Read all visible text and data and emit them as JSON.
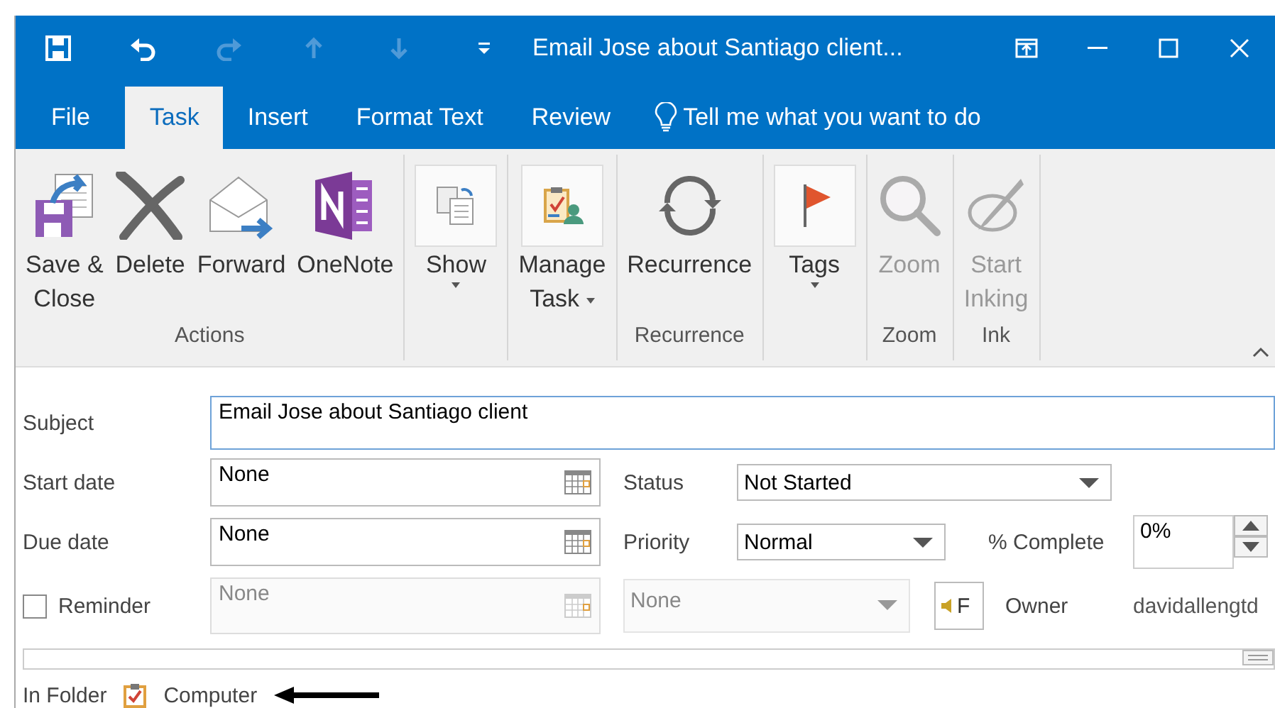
{
  "window": {
    "title": "Email Jose about Santiago client..."
  },
  "tabs": [
    {
      "label": "File",
      "selected": false
    },
    {
      "label": "Task",
      "selected": true
    },
    {
      "label": "Insert",
      "selected": false
    },
    {
      "label": "Format Text",
      "selected": false
    },
    {
      "label": "Review",
      "selected": false
    }
  ],
  "tell_me": {
    "placeholder": "Tell me what you want to do"
  },
  "ribbon": {
    "groups": [
      {
        "label": "Actions",
        "buttons": [
          {
            "kind": "save-close",
            "lines": [
              "Save &",
              "Close"
            ],
            "dropdown": false,
            "disabled": false,
            "framed": false
          },
          {
            "kind": "delete",
            "lines": [
              "Delete"
            ],
            "dropdown": false,
            "disabled": false,
            "framed": false
          },
          {
            "kind": "forward",
            "lines": [
              "Forward"
            ],
            "dropdown": false,
            "disabled": false,
            "framed": false
          },
          {
            "kind": "onenote",
            "lines": [
              "OneNote"
            ],
            "dropdown": false,
            "disabled": false,
            "framed": false
          }
        ]
      },
      {
        "buttons": [
          {
            "kind": "show",
            "lines": [
              "Show"
            ],
            "dropdown": true,
            "disabled": false,
            "framed": true
          }
        ]
      },
      {
        "buttons": [
          {
            "kind": "manage",
            "lines": [
              "Manage",
              "Task"
            ],
            "dropdown": true,
            "disabled": false,
            "framed": true
          }
        ]
      },
      {
        "label": "Recurrence",
        "buttons": [
          {
            "kind": "recurrence",
            "lines": [
              "Recurrence"
            ],
            "dropdown": false,
            "disabled": false,
            "framed": false
          }
        ]
      },
      {
        "buttons": [
          {
            "kind": "tags",
            "lines": [
              "Tags"
            ],
            "dropdown": true,
            "disabled": false,
            "framed": true
          }
        ]
      },
      {
        "label": "Zoom",
        "buttons": [
          {
            "kind": "zoom",
            "lines": [
              "Zoom"
            ],
            "dropdown": false,
            "disabled": true,
            "framed": false
          }
        ]
      },
      {
        "label": "Ink",
        "buttons": [
          {
            "kind": "ink",
            "lines": [
              "Start",
              "Inking"
            ],
            "dropdown": false,
            "disabled": true,
            "framed": false
          }
        ]
      }
    ]
  },
  "form": {
    "subject": {
      "label": "Subject",
      "value": "Email Jose about Santiago client"
    },
    "start_date": {
      "label": "Start date",
      "value": "None"
    },
    "status": {
      "label": "Status",
      "value": "Not Started"
    },
    "due_date": {
      "label": "Due date",
      "value": "None"
    },
    "priority": {
      "label": "Priority",
      "value": "Normal"
    },
    "complete": {
      "label": "% Complete",
      "value": "0%"
    },
    "reminder": {
      "label": "Reminder",
      "checked": false,
      "date": "None",
      "time": "None",
      "disabled": true
    },
    "sound_button": {
      "label": "F"
    },
    "owner": {
      "label": "Owner",
      "value": "davidallengtd"
    },
    "folder": {
      "label": "In Folder",
      "value": "Computer"
    }
  }
}
